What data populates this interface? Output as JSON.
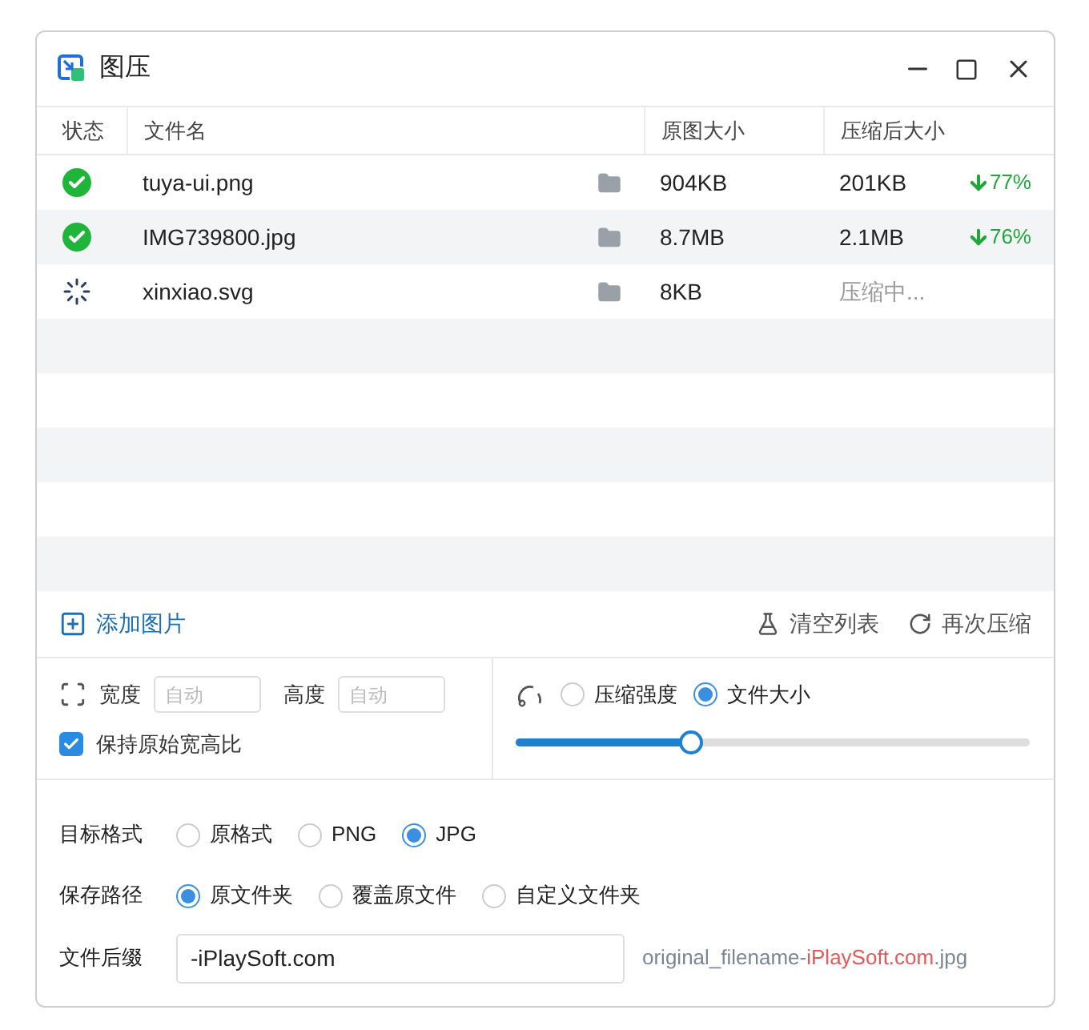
{
  "window": {
    "title": "图压"
  },
  "table": {
    "columns": [
      "状态",
      "文件名",
      "原图大小",
      "压缩后大小"
    ],
    "rows": [
      {
        "kind": "done",
        "name": "tuya-ui.png",
        "original": "904KB",
        "compressed": "201KB",
        "saving": "77%"
      },
      {
        "kind": "done",
        "name": "IMG739800.jpg",
        "original": "8.7MB",
        "compressed": "2.1MB",
        "saving": "76%"
      },
      {
        "kind": "compressing",
        "name": "xinxiao.svg",
        "original": "8KB",
        "compressed": "压缩中..."
      }
    ]
  },
  "toolbar": {
    "add": "添加图片",
    "clear": "清空列表",
    "recompress": "再次压缩"
  },
  "resize": {
    "width_label": "宽度",
    "width_placeholder": "自动",
    "height_label": "高度",
    "height_placeholder": "自动",
    "keep_ratio": {
      "label": "保持原始宽高比",
      "checked": true
    }
  },
  "compression": {
    "modes": [
      {
        "label": "压缩强度",
        "selected": false
      },
      {
        "label": "文件大小",
        "selected": true
      }
    ],
    "level": 0.34
  },
  "format": {
    "label": "目标格式",
    "options": [
      {
        "label": "原格式",
        "selected": false
      },
      {
        "label": "PNG",
        "selected": false
      },
      {
        "label": "JPG",
        "selected": true
      }
    ]
  },
  "save_path": {
    "label": "保存路径",
    "options": [
      {
        "label": "原文件夹",
        "selected": true
      },
      {
        "label": "覆盖原文件",
        "selected": false
      },
      {
        "label": "自定义文件夹",
        "selected": false
      }
    ]
  },
  "suffix": {
    "label": "文件后缀",
    "value": "-iPlaySoft.com",
    "preview": [
      {
        "text": "original_filename-",
        "highlight": false
      },
      {
        "text": "iPlaySoft.com",
        "highlight": true
      },
      {
        "text": ".jpg",
        "highlight": false
      }
    ]
  }
}
